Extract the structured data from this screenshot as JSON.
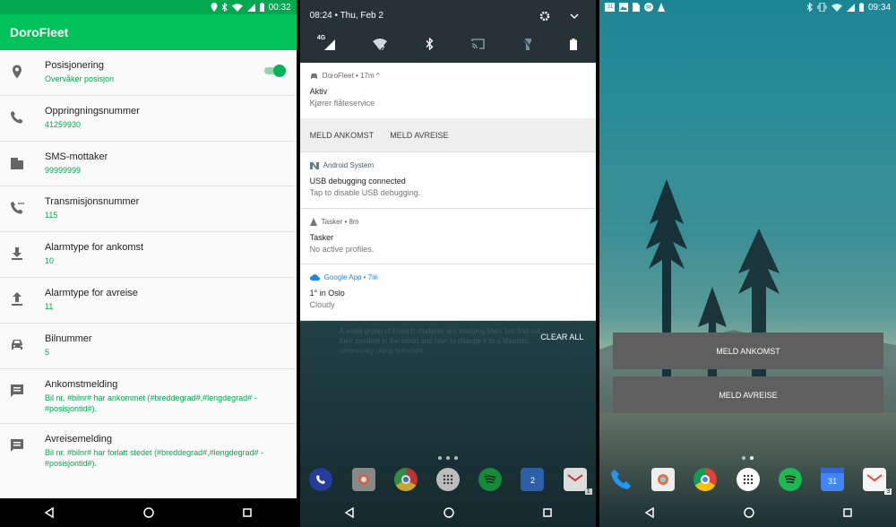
{
  "screen1": {
    "status_time": "00:32",
    "app_title": "DoroFleet",
    "settings": [
      {
        "title": "Posisjonering",
        "subtitle": "Overvåker posisjon"
      },
      {
        "title": "Oppringningsnummer",
        "subtitle": "41259930"
      },
      {
        "title": "SMS-mottaker",
        "subtitle": "99999999"
      },
      {
        "title": "Transmisjonsnummer",
        "subtitle": "115"
      },
      {
        "title": "Alarmtype for ankomst",
        "subtitle": "10"
      },
      {
        "title": "Alarmtype for avreise",
        "subtitle": "11"
      },
      {
        "title": "Bilnummer",
        "subtitle": "5"
      },
      {
        "title": "Ankomstmelding",
        "subtitle": "Bil nr. #bilnr# har ankommet (#breddegrad#,#lengdegrad# - #posisjontid#)."
      },
      {
        "title": "Avreisemelding",
        "subtitle": "Bil nr. #bilnr# har forlatt stedet (#breddegrad#,#lengdegrad# - #posisjontid#)."
      }
    ],
    "toggle_on": true,
    "colors": {
      "accent": "#00c25a",
      "status": "#00a84f"
    }
  },
  "screen2": {
    "date_time": "08:24 • Thu, Feb 2",
    "qs_network_label": "4G",
    "notifications": [
      {
        "app": "DoroFleet • 17m ^",
        "title": "Aktiv",
        "text": "Kjører flåteservice"
      },
      {
        "app": "Android System",
        "title": "USB debugging connected",
        "text": "Tap to disable USB debugging."
      },
      {
        "app": "Tasker • 8m",
        "title": "Tasker",
        "text": "No active profiles."
      },
      {
        "app": "Google App • 7m",
        "title": "1° in Oslo",
        "text": "Cloudy"
      }
    ],
    "actions": [
      "MELD ANKOMST",
      "MELD AVREISE"
    ],
    "clear_all": "CLEAR ALL",
    "background_text": "A small group of French students are studying Mao, but find out their position in the world and how to change it to a Maoistic community using terrorism.",
    "dock_badges": {
      "calendar": "2",
      "gmail": "1"
    }
  },
  "screen3": {
    "status_date": "31",
    "status_time": "09:34",
    "widget_buttons": [
      "MELD ANKOMST",
      "MELD AVREISE"
    ],
    "dock_badges": {
      "calendar": "31",
      "gmail": "3"
    }
  }
}
